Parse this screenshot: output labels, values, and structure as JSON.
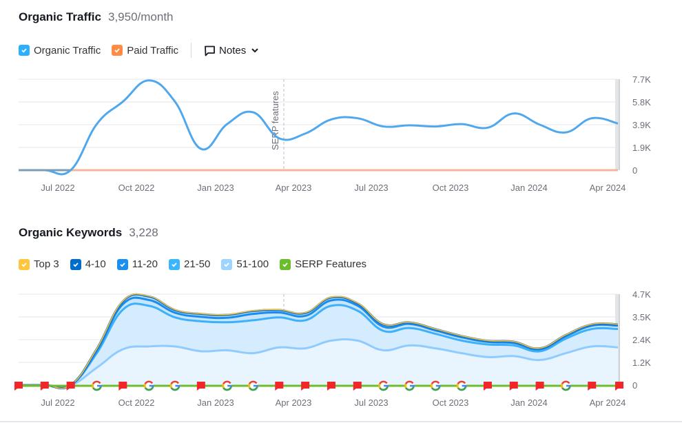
{
  "traffic": {
    "title": "Organic Traffic",
    "metric": "3,950/month",
    "legend": [
      {
        "label": "Organic Traffic",
        "color": "#2bb0ff",
        "checked": true
      },
      {
        "label": "Paid Traffic",
        "color": "#ff8c42",
        "checked": true
      }
    ],
    "notes_label": "Notes",
    "annotation": "SERP features"
  },
  "keywords": {
    "title": "Organic Keywords",
    "metric": "3,228",
    "legend": [
      {
        "label": "Top 3",
        "color": "#ffc53d",
        "checked": true
      },
      {
        "label": "4-10",
        "color": "#006dca",
        "checked": true
      },
      {
        "label": "11-20",
        "color": "#1b8fef",
        "checked": true
      },
      {
        "label": "21-50",
        "color": "#3cb5ff",
        "checked": true
      },
      {
        "label": "51-100",
        "color": "#9fd4ff",
        "checked": true
      },
      {
        "label": "SERP Features",
        "color": "#6cbd2e",
        "checked": true
      }
    ]
  },
  "chart_data": [
    {
      "type": "line",
      "title": "Organic Traffic",
      "x": [
        "May 2022",
        "Jun 2022",
        "Jul 2022",
        "Aug 2022",
        "Sep 2022",
        "Oct 2022",
        "Nov 2022",
        "Dec 2022",
        "Jan 2023",
        "Feb 2023",
        "Mar 2023",
        "Apr 2023",
        "May 2023",
        "Jun 2023",
        "Jul 2023",
        "Aug 2023",
        "Sep 2023",
        "Oct 2023",
        "Nov 2023",
        "Dec 2023",
        "Jan 2024",
        "Feb 2024",
        "Mar 2024",
        "Apr 2024"
      ],
      "x_tick_labels": [
        "Jul 2022",
        "Oct 2022",
        "Jan 2023",
        "Apr 2023",
        "Jul 2023",
        "Oct 2023",
        "Jan 2024",
        "Apr 2024"
      ],
      "y_tick_labels": [
        "0",
        "1.9K",
        "3.9K",
        "5.8K",
        "7.7K"
      ],
      "ylim": [
        0,
        7700
      ],
      "grid": true,
      "series": [
        {
          "name": "Organic Traffic",
          "color": "#4fa8ee",
          "values": [
            0,
            0,
            0,
            3900,
            5800,
            7600,
            5800,
            1800,
            3900,
            4900,
            2700,
            3100,
            4300,
            4400,
            3700,
            3800,
            3700,
            3900,
            3600,
            4800,
            3850,
            3200,
            4400,
            3950
          ]
        },
        {
          "name": "Paid Traffic",
          "color": "#f5b49c",
          "values": [
            0,
            0,
            0,
            0,
            0,
            0,
            0,
            0,
            0,
            0,
            0,
            0,
            0,
            0,
            0,
            0,
            0,
            0,
            0,
            0,
            0,
            0,
            0,
            0
          ]
        }
      ],
      "annotations": [
        {
          "x": "Mar 2023",
          "label": "SERP features"
        }
      ]
    },
    {
      "type": "area",
      "title": "Organic Keywords",
      "stacked": true,
      "x": [
        "May 2022",
        "Jun 2022",
        "Jul 2022",
        "Aug 2022",
        "Sep 2022",
        "Oct 2022",
        "Nov 2022",
        "Dec 2022",
        "Jan 2023",
        "Feb 2023",
        "Mar 2023",
        "Apr 2023",
        "May 2023",
        "Jun 2023",
        "Jul 2023",
        "Aug 2023",
        "Sep 2023",
        "Oct 2023",
        "Nov 2023",
        "Dec 2023",
        "Jan 2024",
        "Feb 2024",
        "Mar 2024",
        "Apr 2024"
      ],
      "x_tick_labels": [
        "Jul 2022",
        "Oct 2022",
        "Jan 2023",
        "Apr 2023",
        "Jul 2023",
        "Oct 2023",
        "Jan 2024",
        "Apr 2024"
      ],
      "y_tick_labels": [
        "0",
        "1.2K",
        "2.4K",
        "3.5K",
        "4.7K"
      ],
      "ylim": [
        0,
        4700
      ],
      "grid": true,
      "series": [
        {
          "name": "51-100",
          "color": "#8fcbff",
          "values": [
            0,
            0,
            0,
            900,
            1850,
            2000,
            2000,
            1750,
            1800,
            1650,
            1950,
            1900,
            2300,
            2300,
            1800,
            2050,
            1900,
            1650,
            1450,
            1500,
            1300,
            1650,
            2000,
            1950
          ]
        },
        {
          "name": "21-50",
          "color": "#3cb0fa",
          "values": [
            0,
            0,
            0,
            750,
            2050,
            2100,
            1500,
            1550,
            1450,
            1700,
            1550,
            1450,
            1800,
            1550,
            1000,
            900,
            750,
            650,
            650,
            550,
            450,
            750,
            900,
            950
          ]
        },
        {
          "name": "11-20",
          "color": "#1a8ced",
          "values": [
            0,
            0,
            0,
            120,
            280,
            300,
            240,
            230,
            230,
            330,
            250,
            230,
            280,
            260,
            220,
            210,
            170,
            170,
            130,
            120,
            100,
            120,
            170,
            170
          ]
        },
        {
          "name": "4-10",
          "color": "#0a6cc4",
          "values": [
            0,
            0,
            0,
            100,
            150,
            180,
            140,
            150,
            150,
            150,
            130,
            150,
            150,
            120,
            120,
            80,
            70,
            70,
            60,
            70,
            50,
            70,
            70,
            70
          ]
        },
        {
          "name": "Top 3",
          "color": "#ffc53d",
          "values": [
            0,
            0,
            0,
            10,
            20,
            20,
            20,
            20,
            20,
            20,
            20,
            20,
            20,
            20,
            10,
            10,
            10,
            10,
            10,
            10,
            10,
            10,
            10,
            10
          ]
        }
      ],
      "serp_feature_markers": [
        "flag",
        "flag",
        "flag",
        "google",
        "flag",
        "google",
        "google",
        "flag",
        "google",
        "google",
        "flag",
        "flag",
        "flag",
        "flag",
        "google",
        "google",
        "google",
        "google",
        "flag",
        "flag",
        "flag",
        "google",
        "flag",
        "flag"
      ],
      "annotations": [
        {
          "x": "Mar 2023",
          "label": ""
        }
      ]
    }
  ]
}
